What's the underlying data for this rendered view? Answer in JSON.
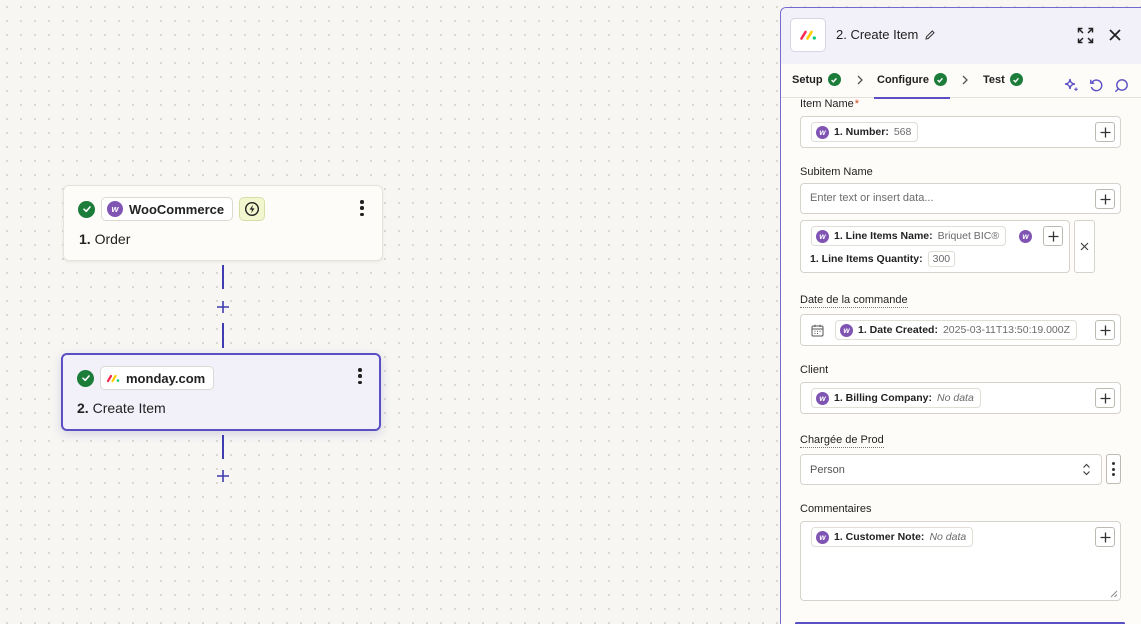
{
  "canvas": {
    "nodes": [
      {
        "app_name": "WooCommerce",
        "step_number": "1.",
        "step_title": "Order"
      },
      {
        "app_name": "monday.com",
        "step_number": "2.",
        "step_title": "Create Item"
      }
    ]
  },
  "panel": {
    "title": "2. Create Item",
    "tabs": [
      {
        "label": "Setup"
      },
      {
        "label": "Configure"
      },
      {
        "label": "Test"
      }
    ],
    "fields": {
      "item_name": {
        "label": "Item Name",
        "required_mark": "*",
        "pill_key": "1. Number:",
        "pill_value": "568"
      },
      "subitem_name": {
        "label": "Subitem Name",
        "placeholder": "Enter text or insert data...",
        "pill1_key": "1. Line Items Name:",
        "pill1_value": "Briquet BIC®",
        "pill2_key": "1. Line Items Quantity:",
        "pill2_value": "300"
      },
      "date": {
        "label": "Date de la commande",
        "pill_key": "1. Date Created:",
        "pill_value": "2025-03-11T13:50:19.000Z"
      },
      "client": {
        "label": "Client",
        "pill_key": "1. Billing Company:",
        "pill_value": "No data"
      },
      "chargee": {
        "label": "Chargée de Prod",
        "value": "Person"
      },
      "commentaires": {
        "label": "Commentaires",
        "pill_key": "1. Customer Note:",
        "pill_value": "No data"
      }
    }
  },
  "colors": {
    "accent": "#5b4fc4",
    "success": "#1c7c3a",
    "woo_purple": "#7f54b3",
    "monday_red": "#f62b54",
    "monday_yellow": "#ffcc00",
    "monday_green": "#00ca72"
  }
}
